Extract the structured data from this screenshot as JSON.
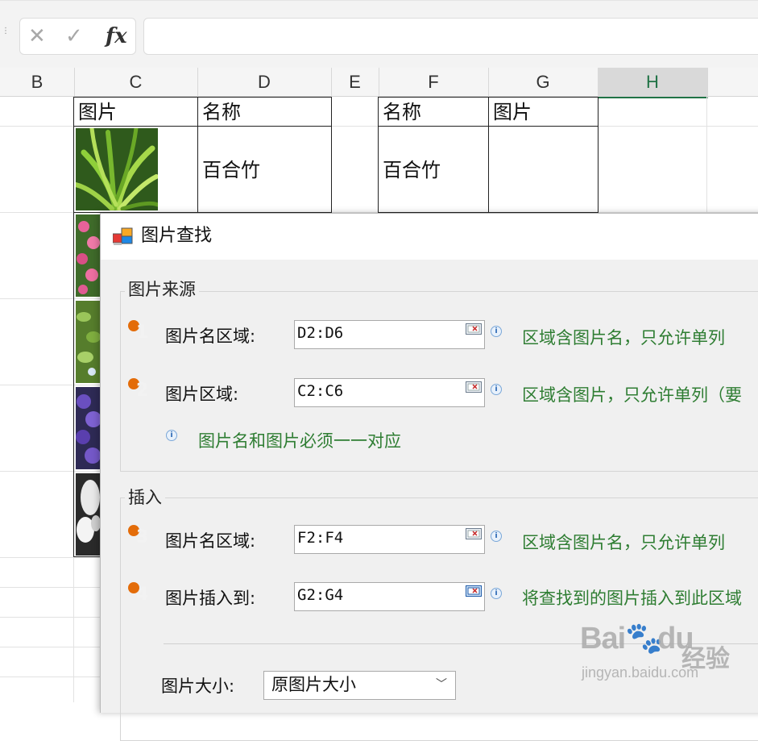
{
  "formula_bar": {
    "cancel_icon": "close-icon",
    "confirm_icon": "check-icon",
    "fx_label": "fx",
    "formula": ""
  },
  "columns": [
    "B",
    "C",
    "D",
    "E",
    "F",
    "G",
    "H"
  ],
  "selected_column": "H",
  "sheet": {
    "c1": "图片",
    "d1": "名称",
    "f1": "名称",
    "g1": "图片",
    "d2": "百合竹",
    "f2": "百合竹"
  },
  "dialog": {
    "title": "图片查找",
    "source_group": {
      "title": "图片来源",
      "name_range_label": "图片名区域:",
      "name_range_value": "D2:D6",
      "name_range_hint": "区域含图片名，只允许单列",
      "pic_range_label": "图片区域:",
      "pic_range_value": "C2:C6",
      "pic_range_hint": "区域含图片，只允许单列（要",
      "match_note": "图片名和图片必须一一对应"
    },
    "insert_group": {
      "title": "插入",
      "name_range_label": "图片名区域:",
      "name_range_value": "F2:F4",
      "name_range_hint": "区域含图片名，只允许单列",
      "target_label": "图片插入到:",
      "target_value": "G2:G4",
      "target_hint": "将查找到的图片插入到此区域"
    },
    "size_label": "图片大小:",
    "size_value": "原图片大小",
    "steps": [
      "1",
      "2",
      "3",
      "4"
    ]
  },
  "watermark": {
    "brand": "Bai",
    "brand2": "du",
    "product": "经验",
    "url": "jingyan.baidu.com"
  }
}
